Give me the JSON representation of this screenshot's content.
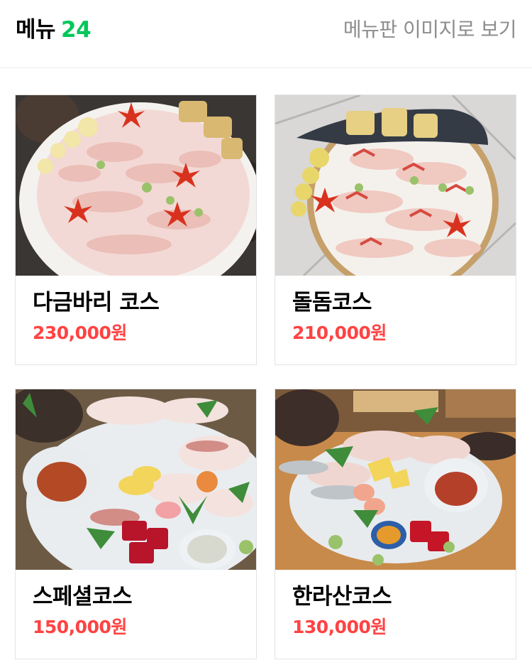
{
  "header": {
    "title": "메뉴",
    "count": "24",
    "view_link": "메뉴판 이미지로 보기"
  },
  "menu_items": [
    {
      "name": "다금바리 코스",
      "price": "230,000원",
      "photo": "sliced-sashimi-platter-photo"
    },
    {
      "name": "돌돔코스",
      "price": "210,000원",
      "photo": "sliced-sashimi-platter-photo"
    },
    {
      "name": "스페셜코스",
      "price": "150,000원",
      "photo": "assorted-sashimi-platter-photo"
    },
    {
      "name": "한라산코스",
      "price": "130,000원",
      "photo": "assorted-sashimi-platter-photo"
    }
  ],
  "colors": {
    "count_green": "#03c75a",
    "price_red": "#ff4343",
    "link_gray": "#8d8d8d"
  }
}
